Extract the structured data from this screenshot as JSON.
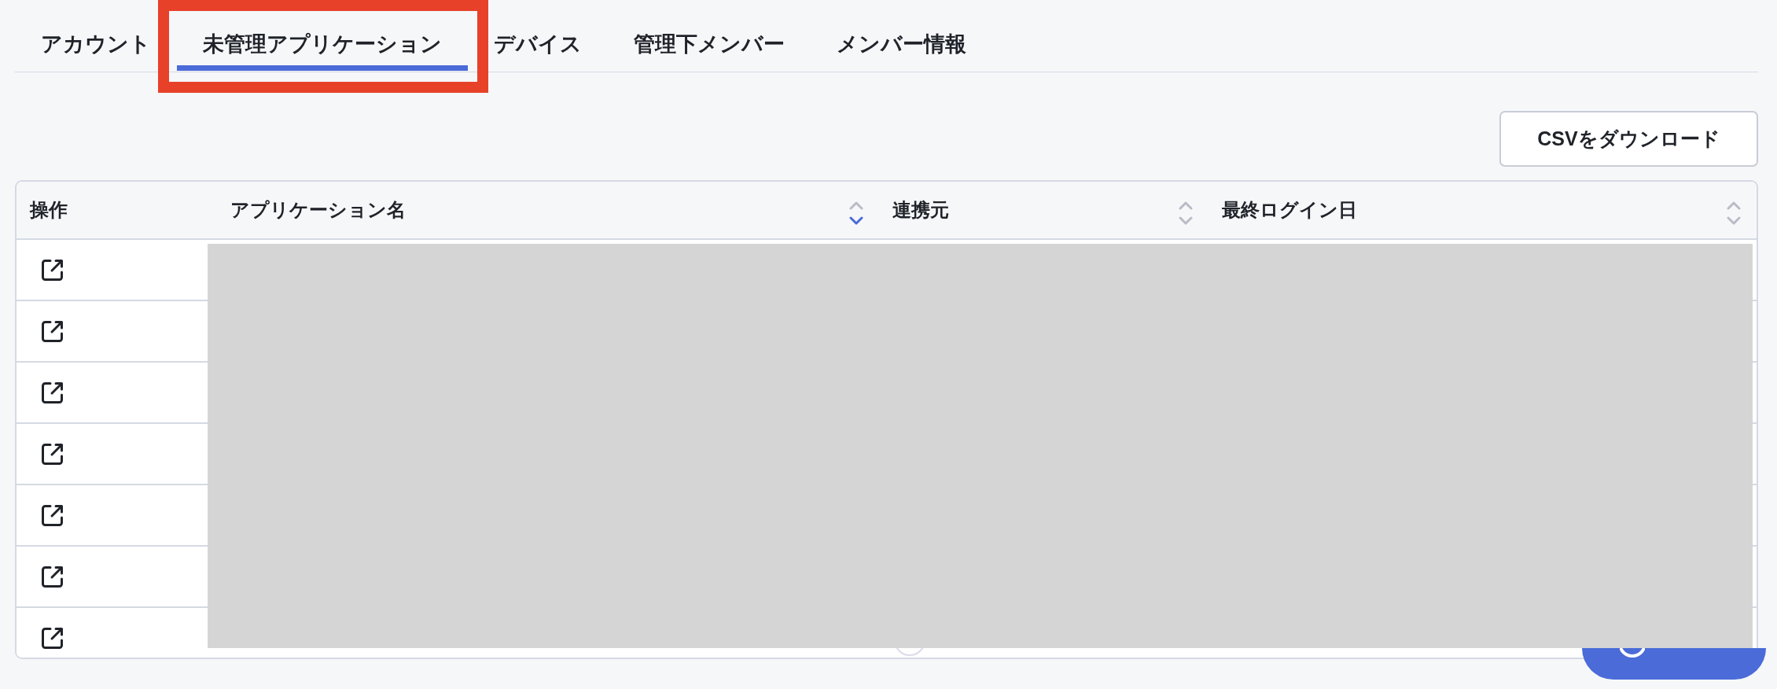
{
  "tabs": [
    {
      "label": "アカウント",
      "selected": false,
      "annotated": false
    },
    {
      "label": "未管理アプリケーション",
      "selected": true,
      "annotated": true
    },
    {
      "label": "デバイス",
      "selected": false,
      "annotated": false
    },
    {
      "label": "管理下メンバー",
      "selected": false,
      "annotated": false
    },
    {
      "label": "メンバー情報",
      "selected": false,
      "annotated": false
    }
  ],
  "toolbar": {
    "download_button": "CSVをダウンロード"
  },
  "table": {
    "columns": [
      {
        "label": "操作",
        "sortable": false
      },
      {
        "label": "アプリケーション名",
        "sortable": true,
        "sorted_descending": true
      },
      {
        "label": "連携元",
        "sortable": true,
        "sorted_descending": false
      },
      {
        "label": "最終ログイン日",
        "sortable": true,
        "sorted_descending": false
      }
    ],
    "rows": [
      {
        "link": true
      },
      {
        "link": true
      },
      {
        "link": true
      },
      {
        "link": true
      },
      {
        "link": true
      },
      {
        "link": true
      },
      {
        "link": true
      }
    ],
    "redacted": true
  }
}
